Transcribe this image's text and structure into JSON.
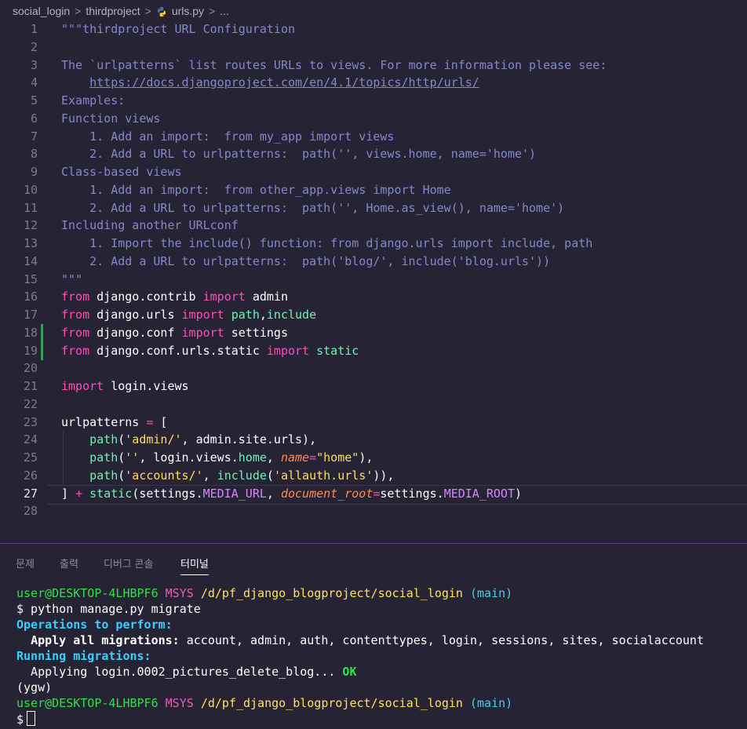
{
  "breadcrumb": {
    "items": [
      "social_login",
      "thirdproject",
      "urls.py",
      "..."
    ],
    "separator": ">"
  },
  "editor": {
    "active_line": 27,
    "lines": [
      {
        "n": "1",
        "tokens": [
          [
            "cm",
            "\"\"\"thirdproject URL Configuration"
          ]
        ]
      },
      {
        "n": "2",
        "tokens": []
      },
      {
        "n": "3",
        "tokens": [
          [
            "cm",
            "The `urlpatterns` list routes URLs to views. For more information please see:"
          ]
        ]
      },
      {
        "n": "4",
        "tokens": [
          [
            "cm",
            "    "
          ],
          [
            "url",
            "https://docs.djangoproject.com/en/4.1/topics/http/urls/"
          ]
        ]
      },
      {
        "n": "5",
        "tokens": [
          [
            "cm",
            "Examples:"
          ]
        ]
      },
      {
        "n": "6",
        "tokens": [
          [
            "cm",
            "Function views"
          ]
        ]
      },
      {
        "n": "7",
        "tokens": [
          [
            "cm",
            "    1. Add an import:  from my_app import views"
          ]
        ]
      },
      {
        "n": "8",
        "tokens": [
          [
            "cm",
            "    2. Add a URL to urlpatterns:  path('', views.home, name='home')"
          ]
        ]
      },
      {
        "n": "9",
        "tokens": [
          [
            "cm",
            "Class-based views"
          ]
        ]
      },
      {
        "n": "10",
        "tokens": [
          [
            "cm",
            "    1. Add an import:  from other_app.views import Home"
          ]
        ]
      },
      {
        "n": "11",
        "tokens": [
          [
            "cm",
            "    2. Add a URL to urlpatterns:  path('', Home.as_view(), name='home')"
          ]
        ]
      },
      {
        "n": "12",
        "tokens": [
          [
            "cm",
            "Including another URLconf"
          ]
        ]
      },
      {
        "n": "13",
        "tokens": [
          [
            "cm",
            "    1. Import the include() function: from django.urls import include, path"
          ]
        ]
      },
      {
        "n": "14",
        "tokens": [
          [
            "cm",
            "    2. Add a URL to urlpatterns:  path('blog/', include('blog.urls'))"
          ]
        ]
      },
      {
        "n": "15",
        "tokens": [
          [
            "cm",
            "\"\"\""
          ]
        ]
      },
      {
        "n": "16",
        "tokens": [
          [
            "kw",
            "from"
          ],
          [
            "plain",
            " django.contrib "
          ],
          [
            "kw",
            "import"
          ],
          [
            "plain",
            " admin"
          ]
        ]
      },
      {
        "n": "17",
        "tokens": [
          [
            "kw",
            "from"
          ],
          [
            "plain",
            " django.urls "
          ],
          [
            "kw",
            "import"
          ],
          [
            "plain",
            " "
          ],
          [
            "fn",
            "path"
          ],
          [
            "plain",
            ","
          ],
          [
            "fn",
            "include"
          ]
        ]
      },
      {
        "n": "18",
        "tokens": [
          [
            "kw",
            "from"
          ],
          [
            "plain",
            " django.conf "
          ],
          [
            "kw",
            "import"
          ],
          [
            "plain",
            " settings"
          ]
        ],
        "mod": true
      },
      {
        "n": "19",
        "tokens": [
          [
            "kw",
            "from"
          ],
          [
            "plain",
            " django.conf.urls.static "
          ],
          [
            "kw",
            "import"
          ],
          [
            "plain",
            " "
          ],
          [
            "fn",
            "static"
          ]
        ],
        "mod": true
      },
      {
        "n": "20",
        "tokens": []
      },
      {
        "n": "21",
        "tokens": [
          [
            "kw",
            "import"
          ],
          [
            "plain",
            " login.views"
          ]
        ]
      },
      {
        "n": "22",
        "tokens": []
      },
      {
        "n": "23",
        "tokens": [
          [
            "plain",
            "urlpatterns "
          ],
          [
            "op",
            "="
          ],
          [
            "plain",
            " ["
          ]
        ]
      },
      {
        "n": "24",
        "tokens": [
          [
            "plain",
            "    "
          ],
          [
            "fn",
            "path"
          ],
          [
            "plain",
            "("
          ],
          [
            "str",
            "'admin/'"
          ],
          [
            "plain",
            ", admin.site.urls),"
          ]
        ],
        "guide": true
      },
      {
        "n": "25",
        "tokens": [
          [
            "plain",
            "    "
          ],
          [
            "fn",
            "path"
          ],
          [
            "plain",
            "("
          ],
          [
            "str",
            "''"
          ],
          [
            "plain",
            ", login.views."
          ],
          [
            "fn",
            "home"
          ],
          [
            "plain",
            ", "
          ],
          [
            "prm",
            "name"
          ],
          [
            "op",
            "="
          ],
          [
            "str",
            "\"home\""
          ],
          [
            "plain",
            "),"
          ]
        ],
        "guide": true
      },
      {
        "n": "26",
        "tokens": [
          [
            "plain",
            "    "
          ],
          [
            "fn",
            "path"
          ],
          [
            "plain",
            "("
          ],
          [
            "str",
            "'accounts/'"
          ],
          [
            "plain",
            ", "
          ],
          [
            "fn",
            "include"
          ],
          [
            "plain",
            "("
          ],
          [
            "str",
            "'allauth.urls'"
          ],
          [
            "plain",
            ")),"
          ]
        ],
        "guide": true
      },
      {
        "n": "27",
        "tokens": [
          [
            "plain",
            "] "
          ],
          [
            "op",
            "+"
          ],
          [
            "plain",
            " "
          ],
          [
            "fn",
            "static"
          ],
          [
            "plain",
            "(settings."
          ],
          [
            "cst",
            "MEDIA_URL"
          ],
          [
            "plain",
            ", "
          ],
          [
            "prm",
            "document_root"
          ],
          [
            "op",
            "="
          ],
          [
            "plain",
            "settings."
          ],
          [
            "cst",
            "MEDIA_ROOT"
          ],
          [
            "plain",
            ")"
          ]
        ]
      },
      {
        "n": "28",
        "tokens": []
      }
    ]
  },
  "panel": {
    "tabs": [
      "문제",
      "출력",
      "디버그 콘솔",
      "터미널"
    ],
    "active_tab": "터미널"
  },
  "terminal": {
    "lines": [
      [
        [
          "t-green",
          "user@DESKTOP-4LHBPF6"
        ],
        [
          "plain",
          " "
        ],
        [
          "t-pink",
          "MSYS"
        ],
        [
          "plain",
          " "
        ],
        [
          "t-yellow",
          "/d/pf_django_blogproject/social_login"
        ],
        [
          "plain",
          " "
        ],
        [
          "t-cyan",
          "(main)"
        ]
      ],
      [
        [
          "plain",
          "$ python manage.py migrate"
        ]
      ],
      [
        [
          "t-bold-cyan",
          "Operations to perform:"
        ]
      ],
      [
        [
          "plain",
          "  "
        ],
        [
          "t-bold",
          "Apply all migrations:"
        ],
        [
          "plain",
          " account, admin, auth, contenttypes, login, sessions, sites, socialaccount"
        ]
      ],
      [
        [
          "t-bold-cyan",
          "Running migrations:"
        ]
      ],
      [
        [
          "plain",
          "  Applying login.0002_pictures_delete_blog... "
        ],
        [
          "t-ok",
          "OK"
        ]
      ],
      [
        [
          "plain",
          "(ygw)"
        ]
      ],
      [
        [
          "t-green",
          "user@DESKTOP-4LHBPF6"
        ],
        [
          "plain",
          " "
        ],
        [
          "t-pink",
          "MSYS"
        ],
        [
          "plain",
          " "
        ],
        [
          "t-yellow",
          "/d/pf_django_blogproject/social_login"
        ],
        [
          "plain",
          " "
        ],
        [
          "t-cyan",
          "(main)"
        ]
      ],
      [
        [
          "plain",
          "$"
        ]
      ]
    ]
  },
  "colors": {
    "background": "#262335",
    "keyword": "#fe4fb6",
    "function": "#72f1b8",
    "string": "#fede5d",
    "docstring": "#8389c9"
  }
}
